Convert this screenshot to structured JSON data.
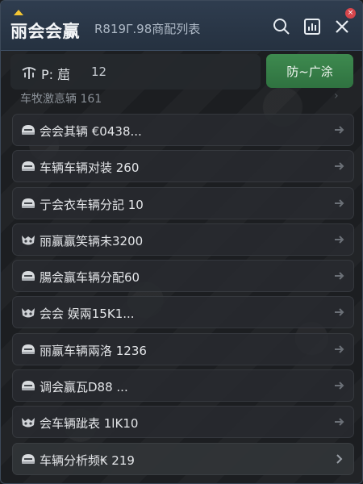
{
  "header": {
    "brand": "丽会会赢",
    "subtitle": "R819Γ.98商配列表",
    "close_badge": "×",
    "icons": {
      "search": "search-icon",
      "chart": "chart-icon",
      "close": "close-icon",
      "crown": "crown-icon"
    }
  },
  "filter": {
    "icon": "filter-icon",
    "label": "P: 䓛",
    "value": "12"
  },
  "action_button": {
    "label": "防~广涂",
    "color": "#3e8a4f"
  },
  "section_header": {
    "label": "车牧激悥辆 161",
    "arrow": "›"
  },
  "list": {
    "items": [
      {
        "label": "会会其辆 €0438...",
        "icon": "helmet-icon"
      },
      {
        "label": "车辆车辆对装 260",
        "icon": "helmet-icon"
      },
      {
        "label": "亍会衣车辆分記 10",
        "icon": "helmet-icon"
      },
      {
        "label": "丽赢赢笑辆未3200",
        "icon": "mask-icon"
      },
      {
        "label": "腸会赢车辆分配60",
        "icon": "helmet-icon"
      },
      {
        "label": "会会 娱兩15K1...",
        "icon": "mask-icon"
      },
      {
        "label": "丽赢车辆兩洛 1236",
        "icon": "helmet-icon"
      },
      {
        "label": "调会赢瓦D88 ...",
        "icon": "helmet-icon"
      },
      {
        "label": "会车辆跐表 1lK10",
        "icon": "mask-icon"
      },
      {
        "label": "车辆分析频₭ 219",
        "icon": "helmet-icon"
      }
    ]
  }
}
